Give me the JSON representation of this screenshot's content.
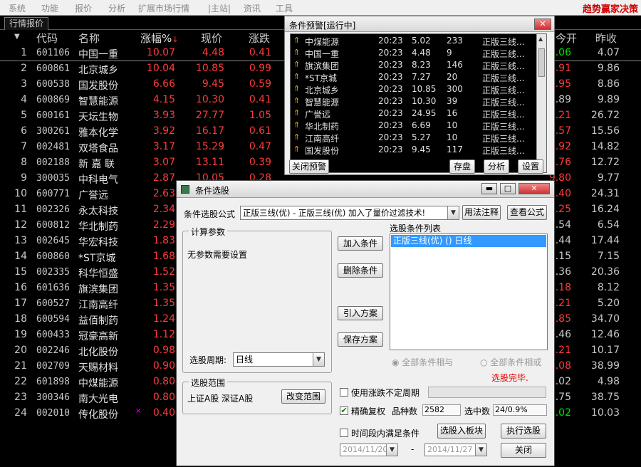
{
  "menu": {
    "items": [
      "系统",
      "功能",
      "报价",
      "分析",
      "扩展市场行情",
      "|主站|",
      "资讯",
      "工具"
    ],
    "slogan": "趋势赢家决策"
  },
  "tab_label": "行情报价",
  "columns": {
    "code": "代码",
    "name": "名称",
    "change_pct": "涨幅%",
    "price": "现价",
    "change": "涨跌",
    "open": "今开",
    "prev": "昨收"
  },
  "stocks": [
    {
      "i": "1",
      "code": "601106",
      "name": "中国一重",
      "pct": "10.07",
      "price": "4.48",
      "chg": "0.41",
      "open": "4.06",
      "open_color": "#00e000",
      "prev": "4.07"
    },
    {
      "i": "2",
      "code": "600861",
      "name": "北京城乡",
      "pct": "10.04",
      "price": "10.85",
      "chg": "0.99",
      "open": "9.91",
      "open_color": "#ff3b3b",
      "prev": "9.86"
    },
    {
      "i": "3",
      "code": "600538",
      "name": "国发股份",
      "pct": "6.66",
      "price": "9.45",
      "chg": "0.59",
      "open": "8.95",
      "open_color": "#ff3b3b",
      "prev": "8.86"
    },
    {
      "i": "4",
      "code": "600869",
      "name": "智慧能源",
      "pct": "4.15",
      "price": "10.30",
      "chg": "0.41",
      "open": "9.89",
      "open_color": "#c8c8c8",
      "prev": "9.89"
    },
    {
      "i": "5",
      "code": "600161",
      "name": "天坛生物",
      "pct": "3.93",
      "price": "27.77",
      "chg": "1.05",
      "open": "27.21",
      "open_color": "#ff3b3b",
      "prev": "26.72"
    },
    {
      "i": "6",
      "code": "300261",
      "name": "雅本化学",
      "pct": "3.92",
      "price": "16.17",
      "chg": "0.61",
      "open": "15.57",
      "open_color": "#ff3b3b",
      "prev": "15.56"
    },
    {
      "i": "7",
      "code": "002481",
      "name": "双塔食品",
      "pct": "3.17",
      "price": "15.29",
      "chg": "0.47",
      "open": "14.92",
      "open_color": "#ff3b3b",
      "prev": "14.82"
    },
    {
      "i": "8",
      "code": "002188",
      "name": "新 嘉 联",
      "pct": "3.07",
      "price": "13.11",
      "chg": "0.39",
      "open": "12.76",
      "open_color": "#ff3b3b",
      "prev": "12.72"
    },
    {
      "i": "9",
      "code": "300035",
      "name": "中科电气",
      "pct": "2.87",
      "price": "10.05",
      "chg": "0.28",
      "open": "9.80",
      "open_color": "#ff3b3b",
      "prev": "9.77"
    },
    {
      "i": "10",
      "code": "600771",
      "name": "广誉远",
      "pct": "2.63",
      "price": "",
      "chg": "",
      "open": "24.40",
      "open_color": "#ff3b3b",
      "prev": "24.31"
    },
    {
      "i": "11",
      "code": "002326",
      "name": "永太科技",
      "pct": "2.34",
      "price": "",
      "chg": "",
      "open": "16.25",
      "open_color": "#ff3b3b",
      "prev": "16.24"
    },
    {
      "i": "12",
      "code": "600812",
      "name": "华北制药",
      "pct": "2.29",
      "price": "",
      "chg": "",
      "open": "6.54",
      "open_color": "#c8c8c8",
      "prev": "6.54"
    },
    {
      "i": "13",
      "code": "002645",
      "name": "华宏科技",
      "pct": "1.83",
      "price": "",
      "chg": "",
      "open": "17.44",
      "open_color": "#c8c8c8",
      "prev": "17.44"
    },
    {
      "i": "14",
      "code": "600860",
      "name": "*ST京城",
      "pct": "1.68",
      "price": "",
      "chg": "",
      "open": "7.15",
      "open_color": "#c8c8c8",
      "prev": "7.15"
    },
    {
      "i": "15",
      "code": "002335",
      "name": "科华恒盛",
      "pct": "1.52",
      "price": "",
      "chg": "",
      "open": "20.36",
      "open_color": "#c8c8c8",
      "prev": "20.36"
    },
    {
      "i": "16",
      "code": "601636",
      "name": "旗滨集团",
      "pct": "1.35",
      "price": "",
      "chg": "",
      "open": "8.18",
      "open_color": "#ff3b3b",
      "prev": "8.12"
    },
    {
      "i": "17",
      "code": "600527",
      "name": "江南高纤",
      "pct": "1.35",
      "price": "",
      "chg": "",
      "open": "5.21",
      "open_color": "#ff3b3b",
      "prev": "5.20"
    },
    {
      "i": "18",
      "code": "600594",
      "name": "益佰制药",
      "pct": "1.24",
      "price": "",
      "chg": "",
      "open": "34.85",
      "open_color": "#ff3b3b",
      "prev": "34.70"
    },
    {
      "i": "19",
      "code": "600433",
      "name": "冠豪高新",
      "pct": "1.12",
      "price": "",
      "chg": "",
      "open": "12.46",
      "open_color": "#c8c8c8",
      "prev": "12.46"
    },
    {
      "i": "20",
      "code": "002246",
      "name": "北化股份",
      "pct": "0.98",
      "price": "",
      "chg": "",
      "open": "10.21",
      "open_color": "#ff3b3b",
      "prev": "10.17"
    },
    {
      "i": "21",
      "code": "002709",
      "name": "天赐材料",
      "pct": "0.90",
      "price": "",
      "chg": "",
      "open": "39.08",
      "open_color": "#ff3b3b",
      "prev": "38.99"
    },
    {
      "i": "22",
      "code": "601898",
      "name": "中煤能源",
      "pct": "0.80",
      "price": "",
      "chg": "",
      "open": "5.02",
      "open_color": "#c8c8c8",
      "prev": "4.98"
    },
    {
      "i": "23",
      "code": "300346",
      "name": "南大光电",
      "pct": "0.80",
      "price": "",
      "chg": "",
      "open": "38.75",
      "open_color": "#c8c8c8",
      "prev": "38.75"
    },
    {
      "i": "24",
      "code": "002010",
      "name": "传化股份",
      "pct": "0.40",
      "price": "",
      "chg": "",
      "open": "10.02",
      "open_color": "#00e000",
      "prev": "10.03"
    }
  ],
  "alert": {
    "title": "条件预警[运行中]",
    "rows": [
      {
        "name": "中煤能源",
        "time": "20:23",
        "price": "5.02",
        "vol": "233",
        "formula": "正版三线..."
      },
      {
        "name": "中国一重",
        "time": "20:23",
        "price": "4.48",
        "vol": "9",
        "formula": "正版三线..."
      },
      {
        "name": "旗滨集团",
        "time": "20:23",
        "price": "8.23",
        "vol": "146",
        "formula": "正版三线..."
      },
      {
        "name": "*ST京城",
        "time": "20:23",
        "price": "7.27",
        "vol": "20",
        "formula": "正版三线..."
      },
      {
        "name": "北京城乡",
        "time": "20:23",
        "price": "10.85",
        "vol": "300",
        "formula": "正版三线..."
      },
      {
        "name": "智慧能源",
        "time": "20:23",
        "price": "10.30",
        "vol": "39",
        "formula": "正版三线..."
      },
      {
        "name": "广誉远",
        "time": "20:23",
        "price": "24.95",
        "vol": "16",
        "formula": "正版三线..."
      },
      {
        "name": "华北制药",
        "time": "20:23",
        "price": "6.69",
        "vol": "10",
        "formula": "正版三线..."
      },
      {
        "name": "江南高纤",
        "time": "20:23",
        "price": "5.27",
        "vol": "10",
        "formula": "正版三线..."
      },
      {
        "name": "国发股份",
        "time": "20:23",
        "price": "9.45",
        "vol": "117",
        "formula": "正版三线..."
      }
    ],
    "btn_close": "关闭预警",
    "btn_save": "存盘",
    "btn_analyze": "分析",
    "btn_settings": "设置"
  },
  "picker": {
    "title": "条件选股",
    "formula_label": "条件选股公式",
    "formula_value": "正版三线(优) - 正版三线(优) 加入了量价过滤技术!",
    "btn_usage": "用法注释",
    "btn_view": "查看公式",
    "params_title": "计算参数",
    "params_text": "无参数需要设置",
    "btn_add": "加入条件",
    "btn_delete": "删除条件",
    "btn_import": "引入方案",
    "btn_save": "保存方案",
    "list_title": "选股条件列表",
    "list_item": "正版三线(优) () 日线",
    "radio_and": "全部条件相与",
    "radio_or": "全部条件相或",
    "status": "选股完毕.",
    "period_label": "选股周期:",
    "period_value": "日线",
    "range_title": "选股范围",
    "range_text": "上证A股 深证A股",
    "btn_range": "改变范围",
    "use_nonfixed": "使用涨跌不定周期",
    "adjust": "精确复权",
    "count_label": "品种数",
    "count": "2582",
    "selected_label": "选中数",
    "selected": "24/0.9%",
    "time_cond": "时间段内满足条件",
    "btn_to_board": "选股入板块",
    "btn_run": "执行选股",
    "date_from": "2014/11/20",
    "date_sep": "-",
    "date_to": "2014/11/27",
    "btn_close": "关闭"
  }
}
